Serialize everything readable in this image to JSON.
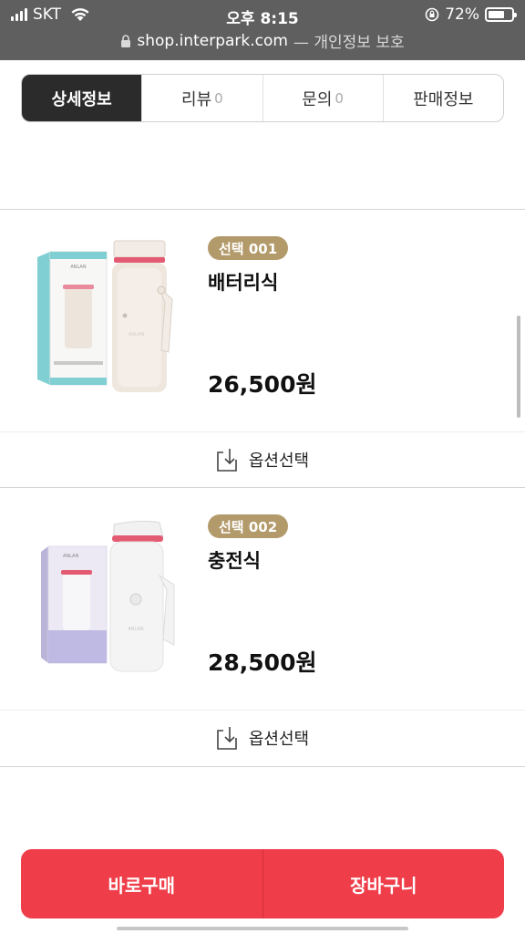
{
  "status_bar": {
    "carrier": "SKT",
    "time": "오후 8:15",
    "battery": "72%",
    "battery_level": 0.72
  },
  "url_bar": {
    "domain": "shop.interpark.com",
    "suffix": "— 개인정보 보호"
  },
  "tabs": [
    {
      "label": "상세정보",
      "count": ""
    },
    {
      "label": "리뷰",
      "count": "0"
    },
    {
      "label": "문의",
      "count": "0"
    },
    {
      "label": "판매정보",
      "count": ""
    }
  ],
  "options": [
    {
      "badge": "선택 001",
      "name": "배터리식",
      "price": "26,500원",
      "select_label": "옵션선택",
      "brand_mark": "ANLAN"
    },
    {
      "badge": "선택 002",
      "name": "충전식",
      "price": "28,500원",
      "select_label": "옵션선택",
      "brand_mark": "ANLAN"
    }
  ],
  "actions": {
    "buy_now": "바로구매",
    "cart": "장바구니"
  },
  "colors": {
    "accent_red": "#ef3e4a",
    "badge_gold": "#b39a6b",
    "active_tab": "#2b2b2b"
  }
}
